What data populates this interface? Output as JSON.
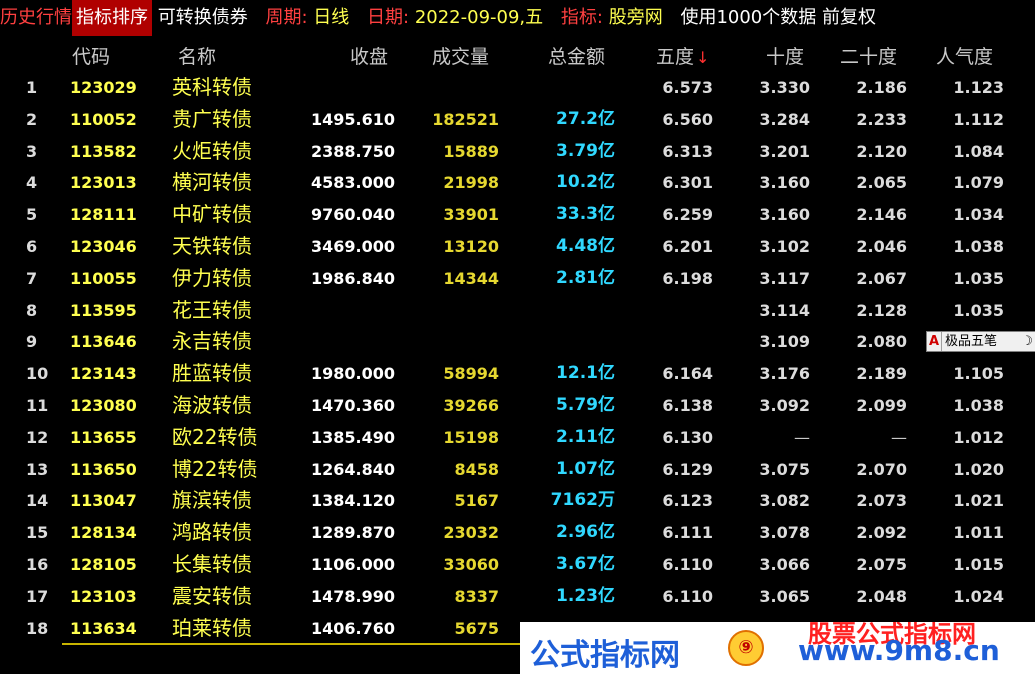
{
  "topbar": {
    "section": "历史行情",
    "title": "指标排序",
    "market": "可转换债券",
    "period_label": "周期:",
    "period_value": "日线",
    "date_label": "日期:",
    "date_value": "2022-09-09,五",
    "indicator_label": "指标:",
    "indicator_value": "股旁网",
    "tail": "使用1000个数据 前复权"
  },
  "columns": {
    "idx": "",
    "code": "代码",
    "name": "名称",
    "close": "收盘",
    "volume": "成交量",
    "amount": "总金额",
    "d5": "五度",
    "sort_arrow": "↓",
    "d10": "十度",
    "d20": "二十度",
    "popularity": "人气度"
  },
  "rows": [
    {
      "idx": "1",
      "code": "123029",
      "name": "英科转债",
      "close": "",
      "volume": "",
      "amount": "",
      "d5": "6.573",
      "d10": "3.330",
      "d20": "2.186",
      "pop": "1.123"
    },
    {
      "idx": "2",
      "code": "110052",
      "name": "贵广转债",
      "close": "1495.610",
      "volume": "182521",
      "amount": "27.2亿",
      "d5": "6.560",
      "d10": "3.284",
      "d20": "2.233",
      "pop": "1.112"
    },
    {
      "idx": "3",
      "code": "113582",
      "name": "火炬转债",
      "close": "2388.750",
      "volume": "15889",
      "amount": "3.79亿",
      "d5": "6.313",
      "d10": "3.201",
      "d20": "2.120",
      "pop": "1.084"
    },
    {
      "idx": "4",
      "code": "123013",
      "name": "横河转债",
      "close": "4583.000",
      "volume": "21998",
      "amount": "10.2亿",
      "d5": "6.301",
      "d10": "3.160",
      "d20": "2.065",
      "pop": "1.079"
    },
    {
      "idx": "5",
      "code": "128111",
      "name": "中矿转债",
      "close": "9760.040",
      "volume": "33901",
      "amount": "33.3亿",
      "d5": "6.259",
      "d10": "3.160",
      "d20": "2.146",
      "pop": "1.034"
    },
    {
      "idx": "6",
      "code": "123046",
      "name": "天铁转债",
      "close": "3469.000",
      "volume": "13120",
      "amount": "4.48亿",
      "d5": "6.201",
      "d10": "3.102",
      "d20": "2.046",
      "pop": "1.038"
    },
    {
      "idx": "7",
      "code": "110055",
      "name": "伊力转债",
      "close": "1986.840",
      "volume": "14344",
      "amount": "2.81亿",
      "d5": "6.198",
      "d10": "3.117",
      "d20": "2.067",
      "pop": "1.035"
    },
    {
      "idx": "8",
      "code": "113595",
      "name": "花王转债",
      "close": "",
      "volume": "",
      "amount": "",
      "d5": "",
      "d10": "3.114",
      "d20": "2.128",
      "pop": "1.035"
    },
    {
      "idx": "9",
      "code": "113646",
      "name": "永吉转债",
      "close": "",
      "volume": "",
      "amount": "",
      "d5": "",
      "d10": "3.109",
      "d20": "2.080",
      "pop": ""
    },
    {
      "idx": "10",
      "code": "123143",
      "name": "胜蓝转债",
      "close": "1980.000",
      "volume": "58994",
      "amount": "12.1亿",
      "d5": "6.164",
      "d10": "3.176",
      "d20": "2.189",
      "pop": "1.105"
    },
    {
      "idx": "11",
      "code": "123080",
      "name": "海波转债",
      "close": "1470.360",
      "volume": "39266",
      "amount": "5.79亿",
      "d5": "6.138",
      "d10": "3.092",
      "d20": "2.099",
      "pop": "1.038"
    },
    {
      "idx": "12",
      "code": "113655",
      "name": "欧22转债",
      "close": "1385.490",
      "volume": "15198",
      "amount": "2.11亿",
      "d5": "6.130",
      "d10": "—",
      "d20": "—",
      "pop": "1.012"
    },
    {
      "idx": "13",
      "code": "113650",
      "name": "博22转债",
      "close": "1264.840",
      "volume": "8458",
      "amount": "1.07亿",
      "d5": "6.129",
      "d10": "3.075",
      "d20": "2.070",
      "pop": "1.020"
    },
    {
      "idx": "14",
      "code": "113047",
      "name": "旗滨转债",
      "close": "1384.120",
      "volume": "5167",
      "amount": "7162万",
      "d5": "6.123",
      "d10": "3.082",
      "d20": "2.073",
      "pop": "1.021"
    },
    {
      "idx": "15",
      "code": "128134",
      "name": "鸿路转债",
      "close": "1289.870",
      "volume": "23032",
      "amount": "2.96亿",
      "d5": "6.111",
      "d10": "3.078",
      "d20": "2.092",
      "pop": "1.011"
    },
    {
      "idx": "16",
      "code": "128105",
      "name": "长集转债",
      "close": "1106.000",
      "volume": "33060",
      "amount": "3.67亿",
      "d5": "6.110",
      "d10": "3.066",
      "d20": "2.075",
      "pop": "1.015"
    },
    {
      "idx": "17",
      "code": "123103",
      "name": "震安转债",
      "close": "1478.990",
      "volume": "8337",
      "amount": "1.23亿",
      "d5": "6.110",
      "d10": "3.065",
      "d20": "2.048",
      "pop": "1.024"
    },
    {
      "idx": "18",
      "code": "113634",
      "name": "珀莱转债",
      "close": "1406.760",
      "volume": "5675",
      "amount": "",
      "d5": "",
      "d10": "",
      "d20": "",
      "pop": ""
    }
  ],
  "ime": {
    "mode": "A",
    "name": "极品五笔",
    "moon": "☽"
  },
  "watermark": {
    "left": "公式指标网",
    "logo": "⑨",
    "right": "www.9m8.cn",
    "top": "股票公式指标网"
  },
  "colors": {
    "background": "#000000",
    "title_bg": "#b00000",
    "label_red": "#ff4040",
    "value_yellow": "#ffff50",
    "amount_cyan": "#30d8ff",
    "volume_gold": "#e6d830"
  }
}
